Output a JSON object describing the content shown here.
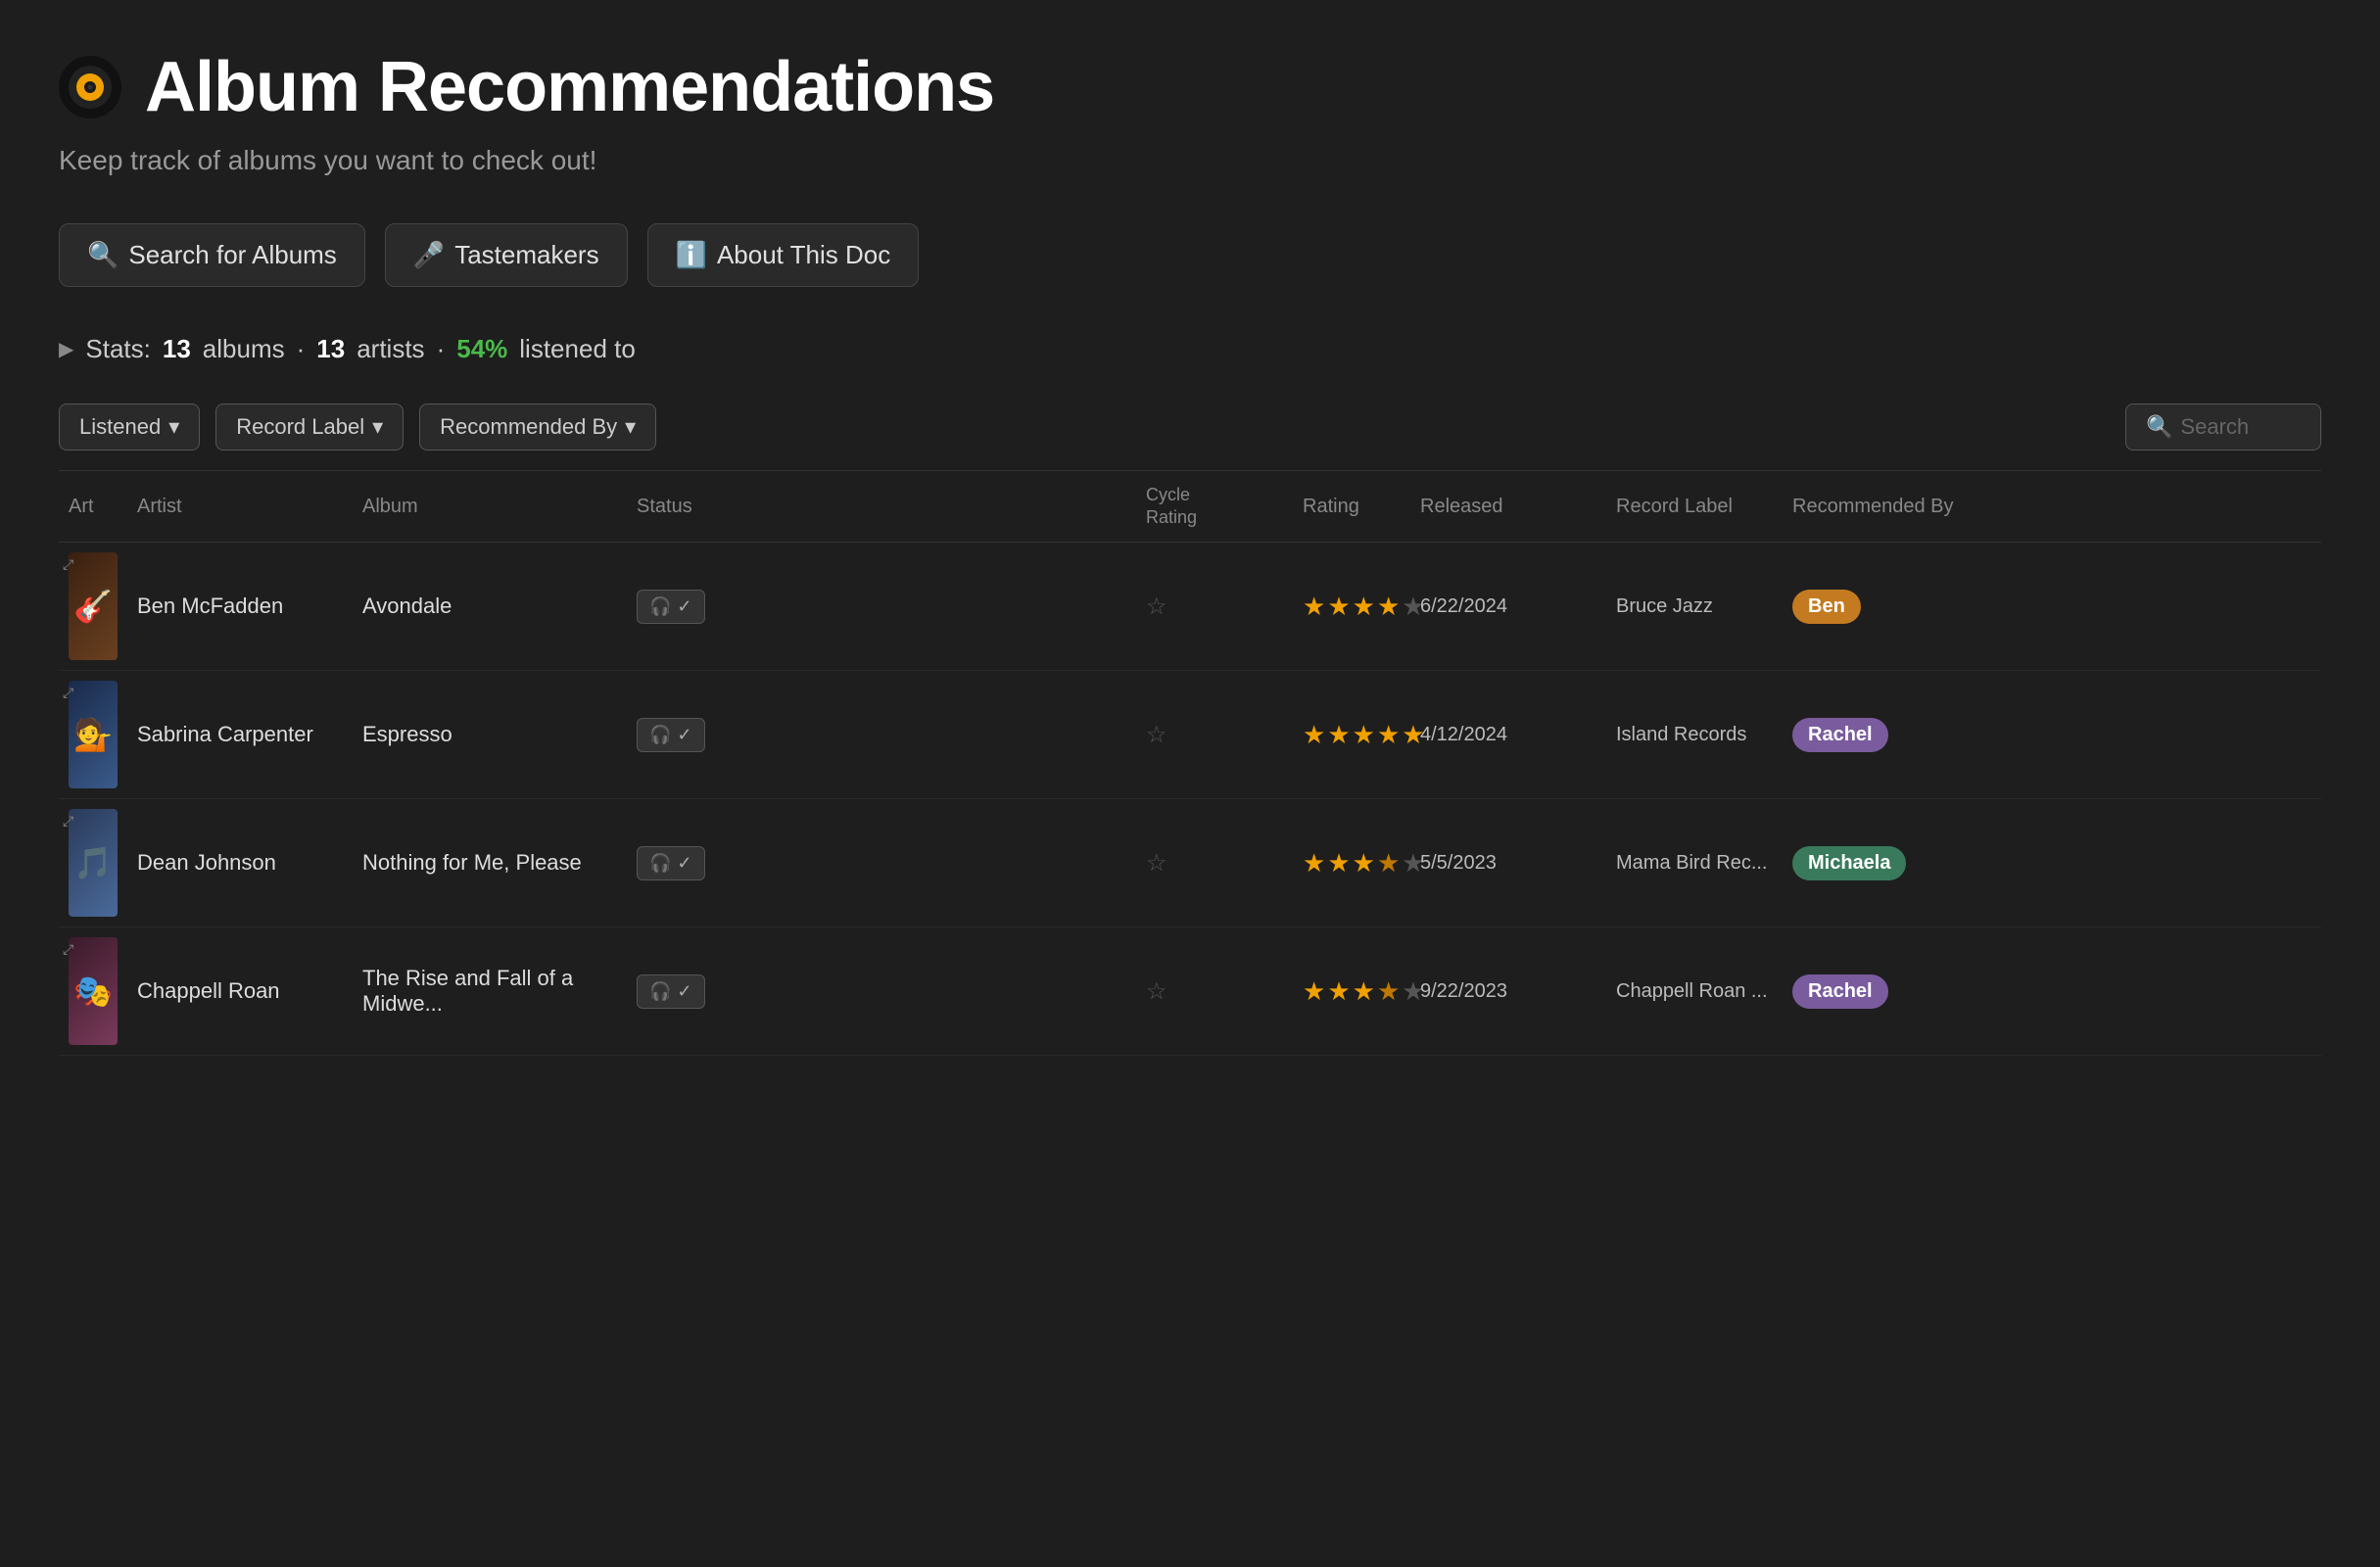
{
  "page": {
    "icon": "vinyl-record",
    "title": "Album Recommendations",
    "subtitle": "Keep track of albums you want to check out!"
  },
  "nav": {
    "buttons": [
      {
        "id": "search-albums",
        "icon": "🔍",
        "label": "Search for Albums"
      },
      {
        "id": "tastemakers",
        "icon": "🎤",
        "label": "Tastemakers"
      },
      {
        "id": "about-doc",
        "icon": "ℹ️",
        "label": "About This Doc"
      }
    ]
  },
  "stats": {
    "label": "Stats:",
    "albums_count": "13",
    "albums_unit": "albums",
    "artists_count": "13",
    "artists_unit": "artists",
    "percent": "54%",
    "percent_label": "listened to"
  },
  "filters": {
    "listened_label": "Listened",
    "record_label_label": "Record Label",
    "recommended_by_label": "Recommended By",
    "search_placeholder": "Search"
  },
  "table": {
    "headers": {
      "art": "Art",
      "artist": "Artist",
      "album": "Album",
      "status": "Status",
      "cycle_rating": "Cycle\nRating",
      "rating": "Rating",
      "released": "Released",
      "record_label": "Record Label",
      "recommended_by": "Recommended By"
    },
    "rows": [
      {
        "art_class": "art-ben",
        "art_emoji": "🎸",
        "artist": "Ben McFadden",
        "album": "Avondale",
        "status": "🎧 ✓",
        "cycle_rating": "☆",
        "rating": 4,
        "released": "6/22/2024",
        "record_label": "Bruce Jazz",
        "recommender": "Ben",
        "recommender_class": "badge-ben"
      },
      {
        "art_class": "art-sabrina",
        "art_emoji": "💁",
        "artist": "Sabrina Carpenter",
        "album": "Espresso",
        "status": "🎧 ✓",
        "cycle_rating": "☆",
        "rating": 5,
        "released": "4/12/2024",
        "record_label": "Island Records",
        "recommender": "Rachel",
        "recommender_class": "badge-rachel"
      },
      {
        "art_class": "art-dean",
        "art_emoji": "🎵",
        "artist": "Dean Johnson",
        "album": "Nothing for Me, Please",
        "status": "🎧 ✓",
        "cycle_rating": "☆",
        "rating": 3.5,
        "released": "5/5/2023",
        "record_label": "Mama Bird Rec...",
        "recommender": "Michaela",
        "recommender_class": "badge-michaela"
      },
      {
        "art_class": "art-chappell",
        "art_emoji": "🎭",
        "artist": "Chappell Roan",
        "album": "The Rise and Fall of a Midwe...",
        "status": "🎧 ✓",
        "cycle_rating": "☆",
        "rating": 3.5,
        "released": "9/22/2023",
        "record_label": "Chappell Roan ...",
        "recommender": "Rachel",
        "recommender_class": "badge-rachel"
      }
    ]
  }
}
